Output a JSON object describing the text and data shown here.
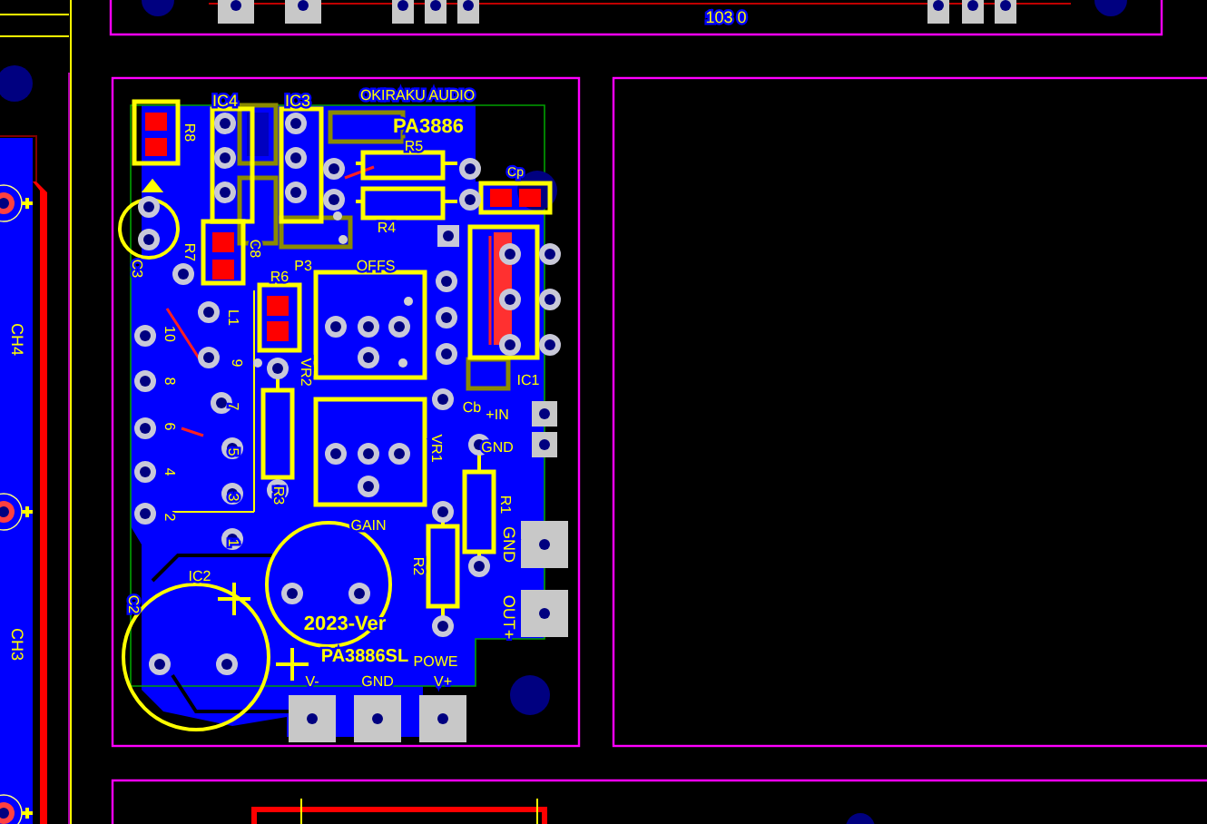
{
  "board": {
    "labels": [
      {
        "text": "IC4"
      },
      {
        "text": "IC3"
      },
      {
        "text": "OKIRAKU AUDIO"
      },
      {
        "text": "PA3886"
      },
      {
        "text": "R8"
      },
      {
        "text": "R5"
      },
      {
        "text": "R4"
      },
      {
        "text": "Cp"
      },
      {
        "text": "C3"
      },
      {
        "text": "R7"
      },
      {
        "text": "C8"
      },
      {
        "text": "P3"
      },
      {
        "text": "OFFS"
      },
      {
        "text": "R6"
      },
      {
        "text": "L1"
      },
      {
        "text": "IC1"
      },
      {
        "text": "VR2"
      },
      {
        "text": "Cb"
      },
      {
        "text": "+IN"
      },
      {
        "text": "GND"
      },
      {
        "text": "VR1"
      },
      {
        "text": "R3"
      },
      {
        "text": "GAIN"
      },
      {
        "text": "R1"
      },
      {
        "text": "R2"
      },
      {
        "text": "GND"
      },
      {
        "text": "OUT+"
      },
      {
        "text": "IC2"
      },
      {
        "text": "C2"
      },
      {
        "text": "2023-Ver"
      },
      {
        "text": "PA3886SL"
      },
      {
        "text": "POWE"
      },
      {
        "text": "V-"
      },
      {
        "text": "GND"
      },
      {
        "text": "V+"
      },
      {
        "text": "1"
      },
      {
        "text": "2"
      },
      {
        "text": "3"
      },
      {
        "text": "4"
      },
      {
        "text": "5"
      },
      {
        "text": "6"
      },
      {
        "text": "7"
      },
      {
        "text": "8"
      },
      {
        "text": "9"
      },
      {
        "text": "10"
      },
      {
        "text": "CH4"
      },
      {
        "text": "CH3"
      },
      {
        "text": "103 0"
      }
    ]
  }
}
